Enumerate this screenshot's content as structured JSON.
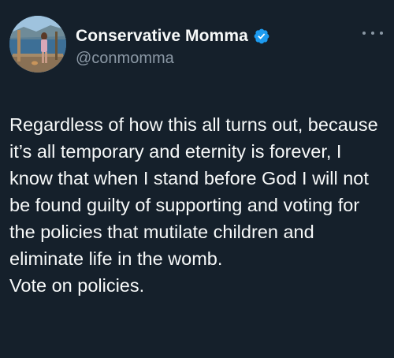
{
  "tweet": {
    "author": {
      "display_name": "Conservative Momma",
      "handle": "@conmomma",
      "verified": true,
      "verified_color": "#1d9bf0"
    },
    "text": "Regardless of how this all turns out, because it’s all temporary and eternity is forever, I know that when I stand before God I will not be found guilty of supporting and voting for the policies that mutilate children and eliminate life in the womb.\nVote on policies.",
    "more_icon": "more-horizontal-icon"
  },
  "theme": {
    "background": "#15202b",
    "text_primary": "#f7f9f9",
    "text_secondary": "#8b98a5"
  }
}
